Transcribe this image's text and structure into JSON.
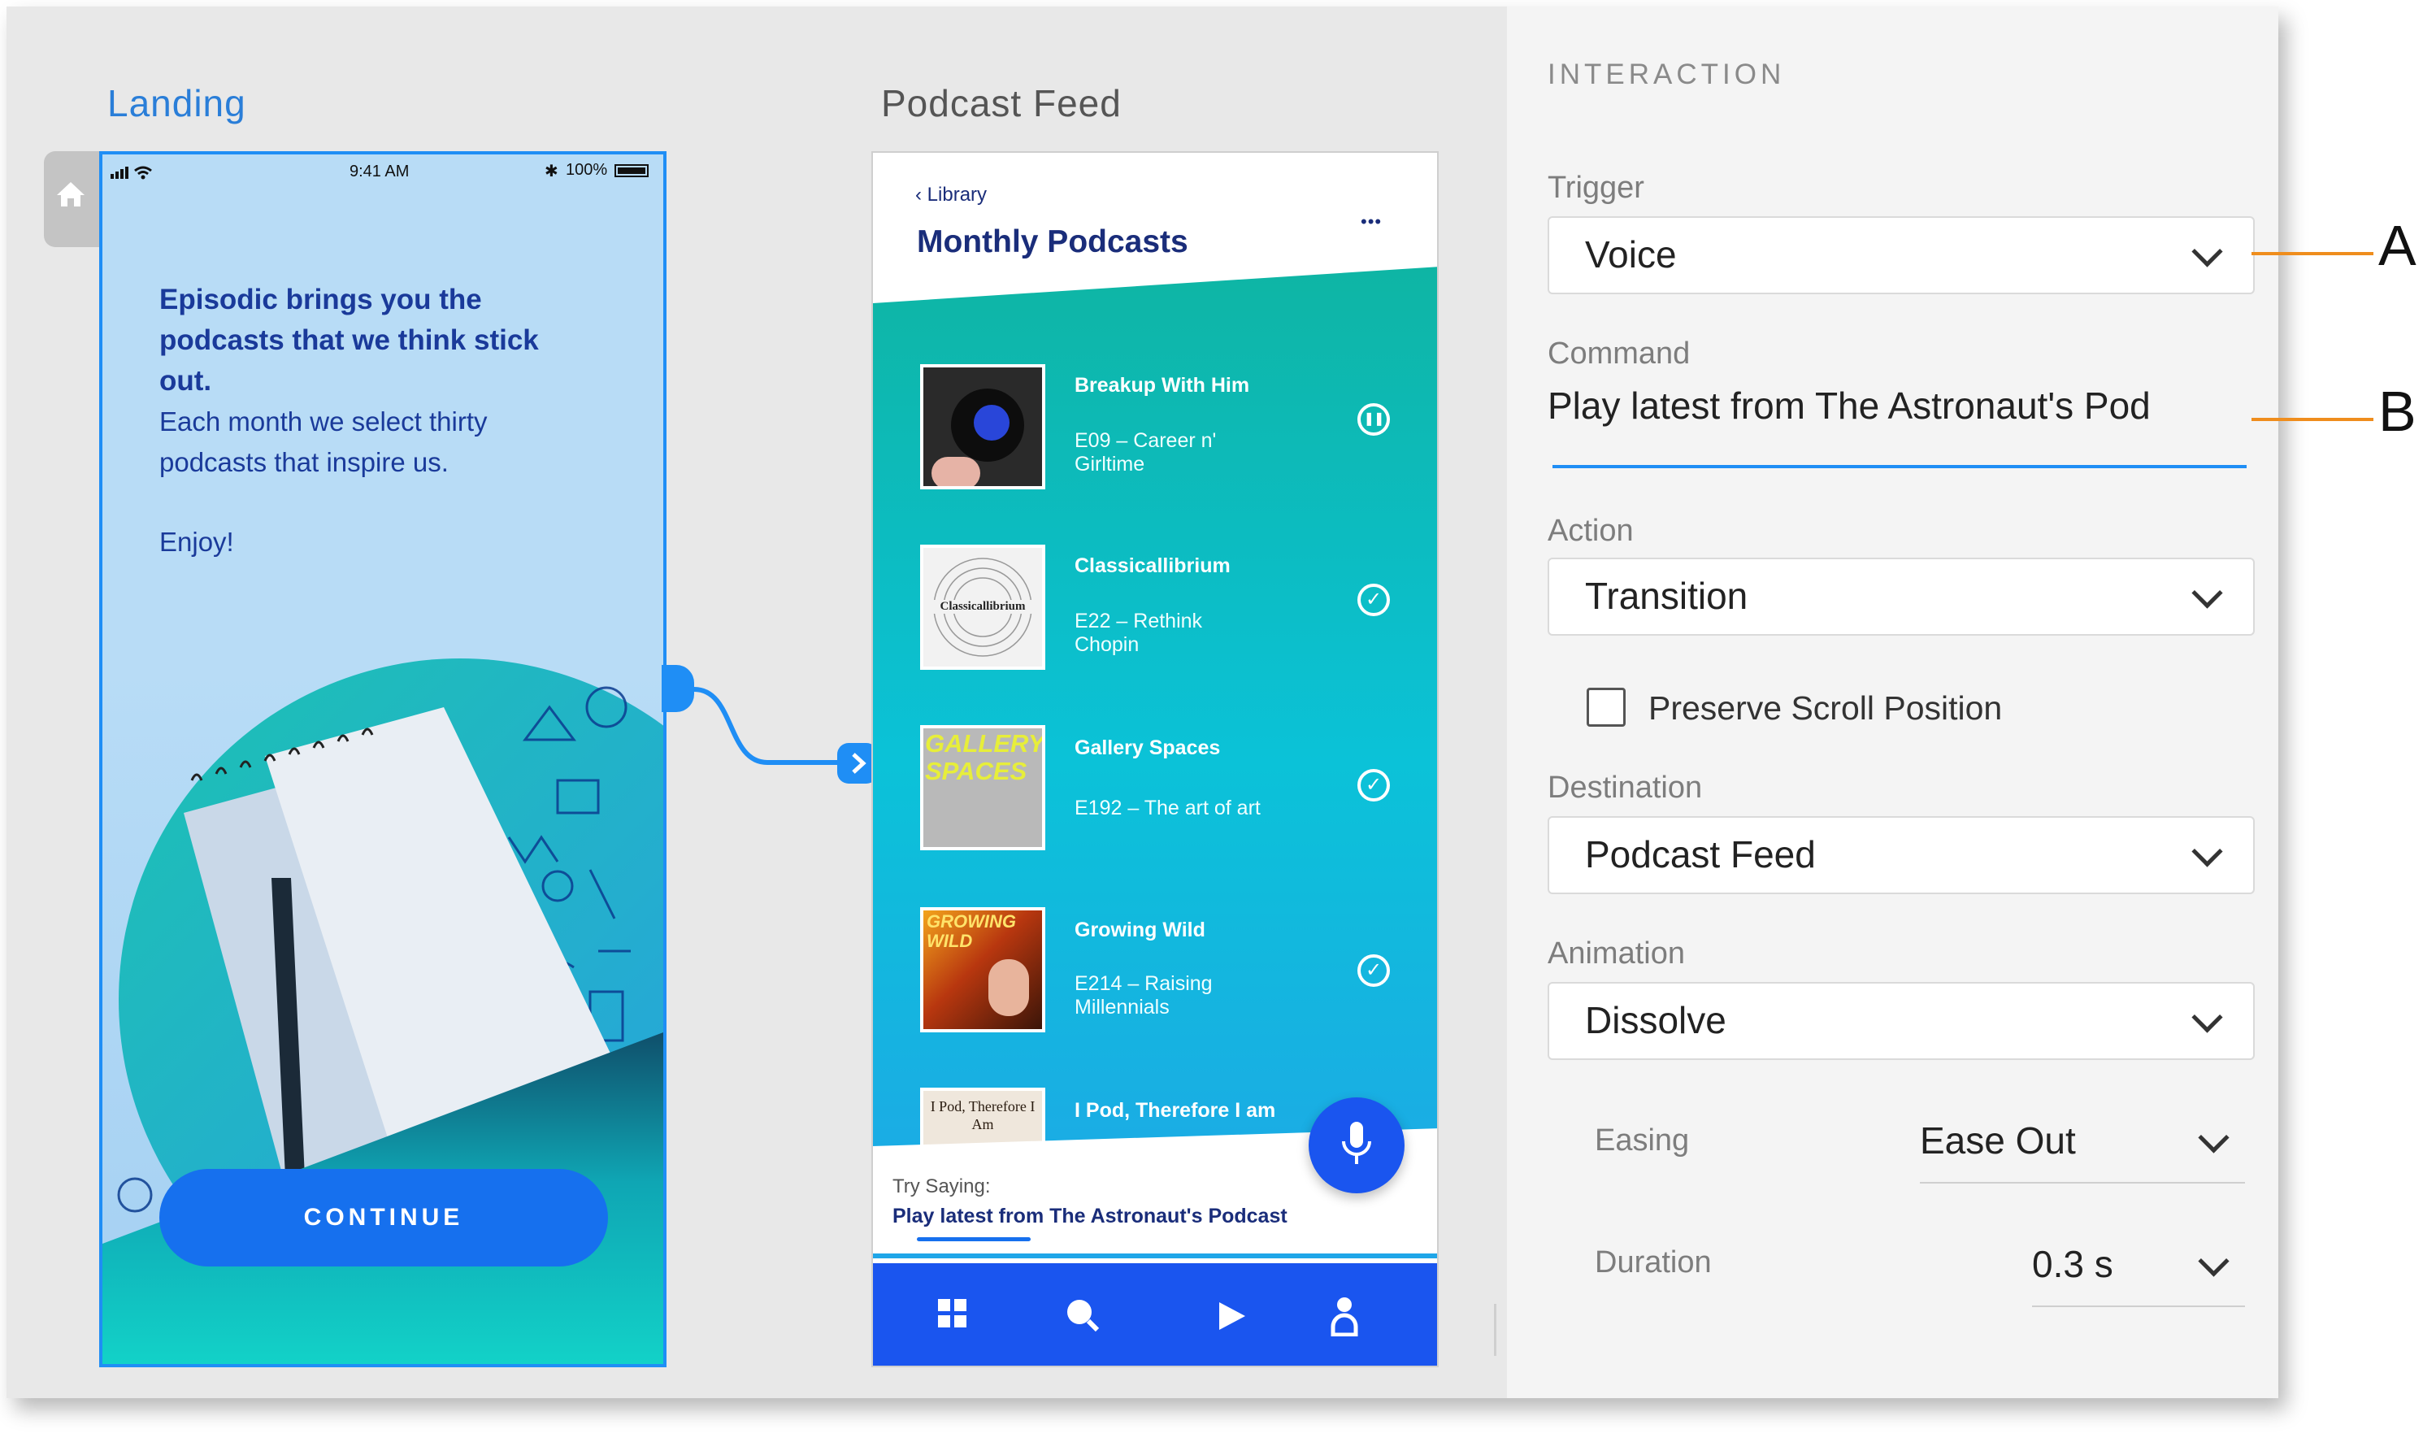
{
  "canvas": {
    "landing_label": "Landing",
    "feed_label": "Podcast Feed"
  },
  "landing": {
    "status": {
      "time": "9:41 AM",
      "battery": "100%"
    },
    "intro_bold": [
      "Episodic brings you the",
      "podcasts that we think stick",
      "out."
    ],
    "intro_body": [
      "Each month we select thirty",
      "podcasts that inspire us."
    ],
    "enjoy": "Enjoy!",
    "continue_label": "CONTINUE"
  },
  "feed": {
    "back_label": "Library",
    "title": "Monthly Podcasts",
    "more_label": "•••",
    "episodes": [
      {
        "title": "Breakup With Him",
        "sub": [
          "E09 – Career n'",
          "Girltime"
        ],
        "status": "pause"
      },
      {
        "title": "Classicallibrium",
        "sub": [
          "E22 – Rethink",
          "Chopin"
        ],
        "status": "check",
        "thumb_text": "Classicallibrium"
      },
      {
        "title": "Gallery Spaces",
        "sub": [
          "E192 – The art of art"
        ],
        "status": "check",
        "thumb_text": "GALLERY SPACES"
      },
      {
        "title": "Growing Wild",
        "sub": [
          "E214 – Raising",
          "Millennials"
        ],
        "status": "check",
        "thumb_text": "GROWING WILD"
      },
      {
        "title": "I Pod, Therefore I am",
        "sub": [],
        "status": "",
        "thumb_text": "I Pod, Therefore I Am"
      }
    ],
    "try_saying_label": "Try Saying:",
    "try_saying_text": "Play latest from The Astronaut's Podcast",
    "nav_icons": [
      "grid-icon",
      "search-icon",
      "play-icon",
      "profile-icon"
    ]
  },
  "panel": {
    "header": "INTERACTION",
    "trigger_label": "Trigger",
    "trigger_value": "Voice",
    "command_label": "Command",
    "command_value": "Play latest from The Astronaut's Pod",
    "action_label": "Action",
    "action_value": "Transition",
    "preserve_label": "Preserve Scroll Position",
    "preserve_checked": false,
    "destination_label": "Destination",
    "destination_value": "Podcast Feed",
    "animation_label": "Animation",
    "animation_value": "Dissolve",
    "easing_label": "Easing",
    "easing_value": "Ease Out",
    "duration_label": "Duration",
    "duration_value": "0.3 s"
  },
  "callouts": {
    "a": "A",
    "b": "B"
  },
  "colors": {
    "accent": "#1f8ef5",
    "callout": "#ef8d1d",
    "nav_blue": "#1a55ef",
    "heading_navy": "#1a2d7a"
  }
}
